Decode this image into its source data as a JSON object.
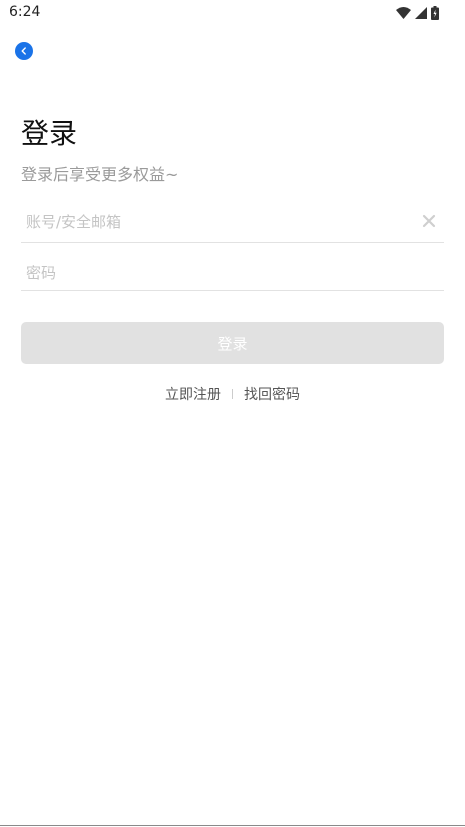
{
  "status_bar": {
    "time": "6:24"
  },
  "header": {
    "back_icon": "chevron-left-icon"
  },
  "main": {
    "title": "登录",
    "subtitle": "登录后享受更多权益~",
    "account": {
      "placeholder": "账号/安全邮箱",
      "value": ""
    },
    "password": {
      "placeholder": "密码",
      "value": ""
    },
    "login_label": "登录",
    "register_link": "立即注册",
    "recover_link": "找回密码"
  },
  "colors": {
    "accent": "#1a73e8",
    "button_disabled": "#e1e1e1",
    "placeholder": "#c4c4c4",
    "subtitle": "#9a9a9a"
  }
}
